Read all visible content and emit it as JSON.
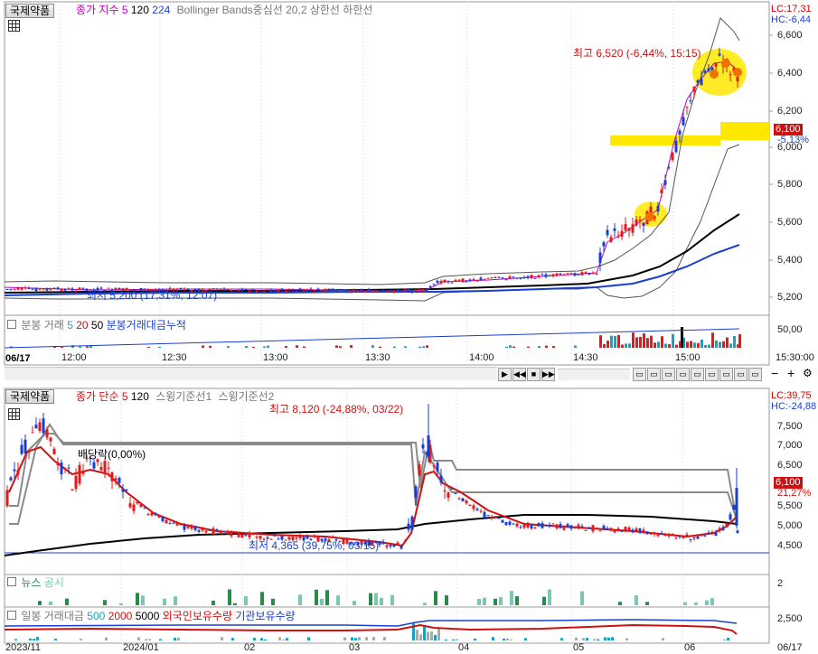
{
  "top": {
    "tab": "국제약품",
    "legend": {
      "type": "종가 지수",
      "p1": "5",
      "p2": "120",
      "p3": "224",
      "bb": "Bollinger Bands중심선 20,2  상한선  하한선"
    },
    "lc": "LC:17,31",
    "hc": "HC:-6,44",
    "hi_note": "최고 6,520 (-6,44%, 15:15)",
    "lo_note": "최저 5,200 (17,31%, 12:07)",
    "price_box": "6,100",
    "price_pct": "-5,13%",
    "y_ticks": [
      "6,600",
      "6,400",
      "6,200",
      "6,000",
      "5,800",
      "5,600",
      "5,400",
      "5,200"
    ],
    "vol_legend": {
      "label": "분봉 거래",
      "p1": "5",
      "p2": "20",
      "p3": "50",
      "acc": "분봉거래대금누적"
    },
    "vol_tick": "50,00",
    "date": "06/17",
    "x_ticks": [
      "12:00",
      "12:30",
      "13:00",
      "13:30",
      "14:00",
      "14:30",
      "15:00",
      "15:30:00"
    ]
  },
  "bottom": {
    "tab": "국제약품",
    "legend": {
      "type": "종가 단순",
      "p1": "5",
      "p2": "120",
      "s1": "스윙기준선1",
      "s2": "스윙기준선2"
    },
    "lc": "LC:39,75",
    "hc": "HC:-24,88",
    "hi_note": "최고 8,120 (-24,88%, 03/22)",
    "lo_note": "최저 4,365 (39,75%, 03/15)",
    "div_note": "배당락(0,00%)",
    "price_box": "6,100",
    "price_pct": "21,27%",
    "y_ticks": [
      "7,500",
      "7,000",
      "6,500",
      "5,500",
      "5,000",
      "4,500"
    ],
    "news": {
      "news": "뉴스",
      "notice": "공시",
      "tick": "2"
    },
    "vol_legend": {
      "label": "일봉 거래대금",
      "p1": "500",
      "p2": "2000",
      "p3": "5000",
      "foreign": "외국인보유수량",
      "inst": "기관보유수량"
    },
    "vol_tick": "2,500",
    "x_ticks": [
      "2023/11",
      "2024/01",
      "02",
      "03",
      "04",
      "05",
      "06",
      "06/17"
    ]
  },
  "colors": {
    "up": "#e41a1a",
    "down": "#1a3fcf",
    "highlight": "#ffe800",
    "price_box": "#d01010"
  }
}
